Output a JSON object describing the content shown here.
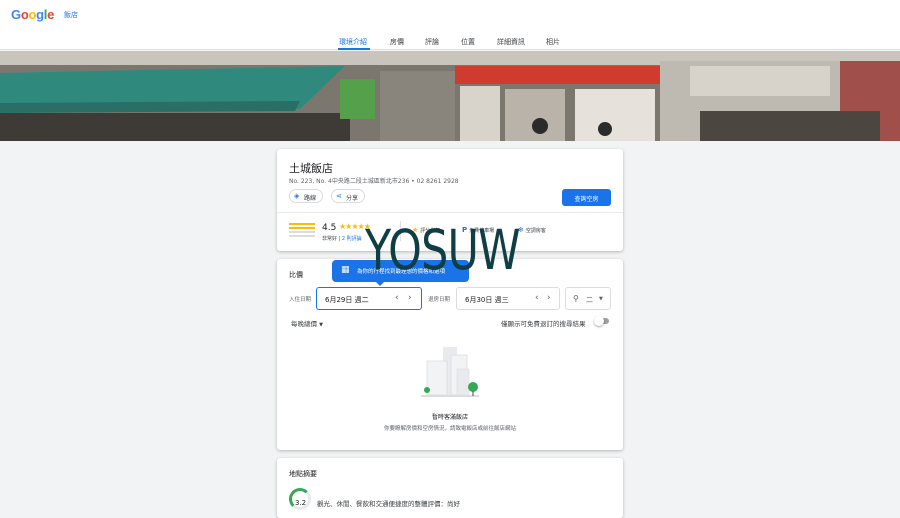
{
  "header": {
    "logo_letters": [
      "G",
      "o",
      "o",
      "g",
      "l",
      "e"
    ],
    "breadcrumb": "飯店"
  },
  "tabs": [
    {
      "label": "環境介紹",
      "active": true
    },
    {
      "label": "房價",
      "active": false
    },
    {
      "label": "評論",
      "active": false
    },
    {
      "label": "位置",
      "active": false
    },
    {
      "label": "詳細資訊",
      "active": false
    },
    {
      "label": "相片",
      "active": false
    }
  ],
  "hotel": {
    "name": "土城飯店",
    "address": "No. 223, No. 4中央路二段土城區新北市236 • 02 8261 2928",
    "directions_label": "路線",
    "share_label": "分享",
    "check_availability_label": "查詢空房",
    "rating": "4.5",
    "rating_word": "非常好",
    "review_link": "2 則評論",
    "amenities": [
      {
        "icon": "star-icon",
        "label": "評分尚無"
      },
      {
        "icon": "parking-icon",
        "label": "免費停車場"
      },
      {
        "icon": "ac-icon",
        "label": "空調房客"
      }
    ]
  },
  "prices": {
    "title": "比價",
    "tooltip": "為你的行程找到最理想的價格和選項",
    "checkin_label": "入住日期",
    "checkin_value": "6月29日 週二",
    "checkout_label": "退房日期",
    "checkout_value": "6月30日 週三",
    "guests_value": "二",
    "sort_label": "每晚總價",
    "free_cancel_label": "僅顯示可免費退訂的搜尋結果",
    "empty_title": "暫時客滿飯店",
    "empty_sub": "你要瞭解房價和空房情況，請致電飯店或前往飯店網站"
  },
  "location": {
    "title": "地點摘要",
    "score": "3.2",
    "summary": "觀光、休閒、餐飲和交通便捷度的整體評價：尚好"
  },
  "overlay": {
    "watermark": "YOSUW"
  },
  "colors": {
    "accent": "#1a73e8",
    "star": "#fbbc04",
    "good": "#34a853"
  }
}
